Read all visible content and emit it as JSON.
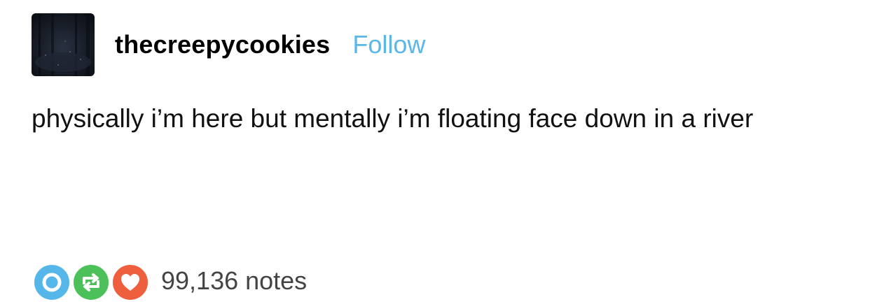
{
  "post": {
    "username": "thecreepycookies",
    "follow_label": "Follow",
    "body_text": "physically i’m here but mentally i’m floating face down in a river",
    "notes_label": "99,136 notes"
  },
  "icons": {
    "avatar": "avatar-dark-forest-photo",
    "reply": "reply-icon",
    "reblog": "reblog-icon",
    "like": "heart-icon"
  },
  "colors": {
    "follow": "#5bb7ea",
    "reply": "#55b6ea",
    "reblog": "#4cc159",
    "like": "#ee5f3e"
  }
}
